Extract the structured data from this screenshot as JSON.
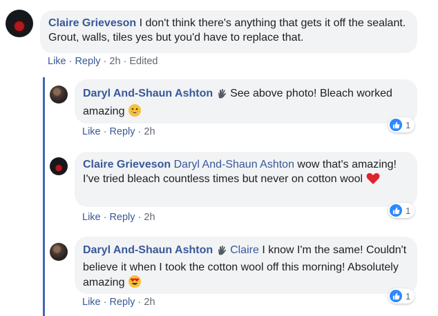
{
  "comments": [
    {
      "author": "Claire Grieveson",
      "text": "I don't think there's anything that gets it off the sealant. Grout, walls, tiles yes but you'd have to replace that.",
      "actions": {
        "like": "Like",
        "reply": "Reply",
        "time": "2h",
        "edited": "Edited"
      }
    }
  ],
  "replies": [
    {
      "author": "Daryl And-Shaun Ashton",
      "text": "See above photo! Bleach worked amazing",
      "emoji": "grinning-face-emoji",
      "actions": {
        "like": "Like",
        "reply": "Reply",
        "time": "2h"
      },
      "reaction_count": "1"
    },
    {
      "author": "Claire Grieveson",
      "mention": "Daryl And-Shaun Ashton",
      "text": "wow that's amazing! I've tried bleach countless times but never on cotton wool",
      "emoji": "red-heart-emoji",
      "actions": {
        "like": "Like",
        "reply": "Reply",
        "time": "2h"
      },
      "reaction_count": "1"
    },
    {
      "author": "Daryl And-Shaun Ashton",
      "mention": "Claire",
      "text": "I know I'm the same! Couldn't believe it when I took the cotton wool off this morning! Absolutely amazing",
      "emoji": "heart-eyes-emoji",
      "actions": {
        "like": "Like",
        "reply": "Reply",
        "time": "2h"
      },
      "reaction_count": "1"
    }
  ],
  "colors": {
    "author": "#385898",
    "bubble": "#f2f3f5",
    "like_blue": "#2d88ff",
    "thread_line": "#4267b2"
  }
}
